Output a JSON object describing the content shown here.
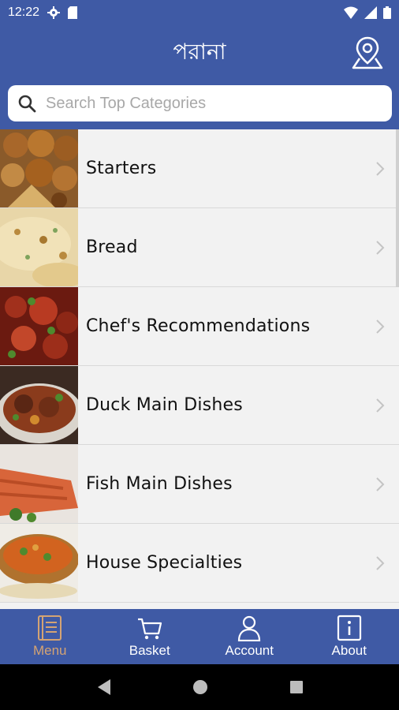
{
  "status_bar": {
    "time": "12:22"
  },
  "header": {
    "brand": "পরানা",
    "map_icon": "map-pin-icon"
  },
  "search": {
    "placeholder": "Search Top Categories",
    "value": ""
  },
  "categories": [
    {
      "label": "Starters",
      "thumb": "starters"
    },
    {
      "label": "Bread",
      "thumb": "bread"
    },
    {
      "label": "Chef's Recommendations",
      "thumb": "chef"
    },
    {
      "label": "Duck Main Dishes",
      "thumb": "duck"
    },
    {
      "label": "Fish Main Dishes",
      "thumb": "fish"
    },
    {
      "label": "House Specialties",
      "thumb": "house"
    }
  ],
  "tabs": [
    {
      "label": "Menu",
      "icon": "menu-book-icon",
      "active": true
    },
    {
      "label": "Basket",
      "icon": "basket-icon",
      "active": false
    },
    {
      "label": "Account",
      "icon": "account-icon",
      "active": false
    },
    {
      "label": "About",
      "icon": "info-icon",
      "active": false
    }
  ],
  "colors": {
    "primary": "#3f5aa5",
    "active_tab": "#d4a373",
    "list_bg": "#f2f2f2"
  }
}
